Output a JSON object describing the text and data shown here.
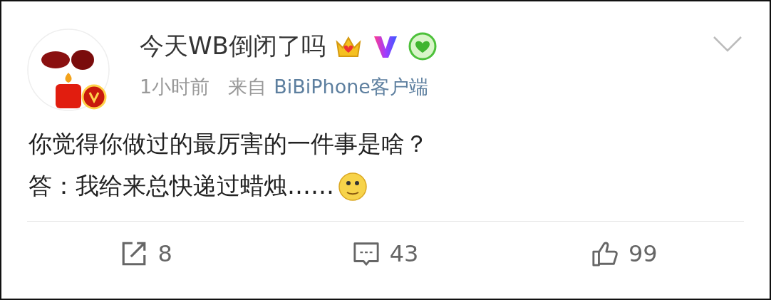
{
  "post": {
    "author": "今天WB倒闭了吗",
    "time": "1小时前",
    "source_prefix": "来自",
    "source": "BiBiPhone客户端",
    "lines": [
      "你觉得你做过的最厉害的一件事是啥？",
      "答：我给来总快递过蜡烛……"
    ],
    "actions": [
      {
        "kind": "repost",
        "count": "8"
      },
      {
        "kind": "comment",
        "count": "43"
      },
      {
        "kind": "like",
        "count": "99"
      }
    ]
  }
}
